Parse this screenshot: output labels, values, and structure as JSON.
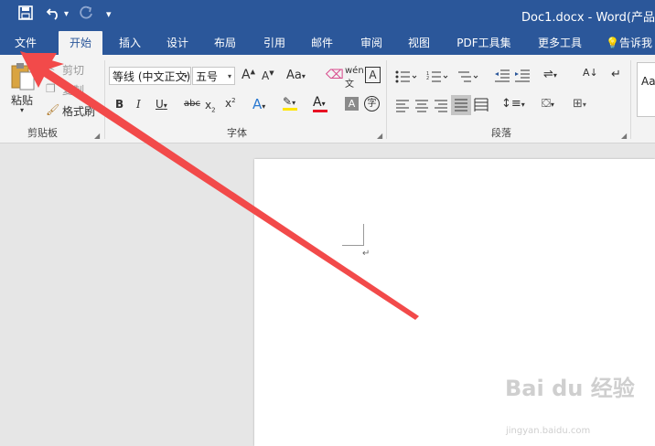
{
  "quick_access": {
    "save": "save-icon",
    "undo": "undo-icon",
    "redo": "redo-icon",
    "customize": "▾"
  },
  "title": "Doc1.docx - Word(产品",
  "tabs": [
    {
      "label": "文件"
    },
    {
      "label": "开始"
    },
    {
      "label": "插入"
    },
    {
      "label": "设计"
    },
    {
      "label": "布局"
    },
    {
      "label": "引用"
    },
    {
      "label": "邮件"
    },
    {
      "label": "审阅"
    },
    {
      "label": "视图"
    },
    {
      "label": "PDF工具集"
    },
    {
      "label": "更多工具"
    }
  ],
  "tell_me": "告诉我",
  "clipboard": {
    "paste": "粘贴",
    "cut": "剪切",
    "copy": "复制",
    "format_painter": "格式刷",
    "group": "剪贴板"
  },
  "font": {
    "name": "等线 (中文正文)",
    "size": "五号",
    "group": "字体"
  },
  "paragraph": {
    "group": "段落"
  },
  "styles": {
    "preview": "Aa"
  },
  "watermark": {
    "brand": "Bai du 经验",
    "url": "jingyan.baidu.com"
  },
  "colors": {
    "accent": "#2b579a",
    "arrow": "#f24a4a"
  }
}
